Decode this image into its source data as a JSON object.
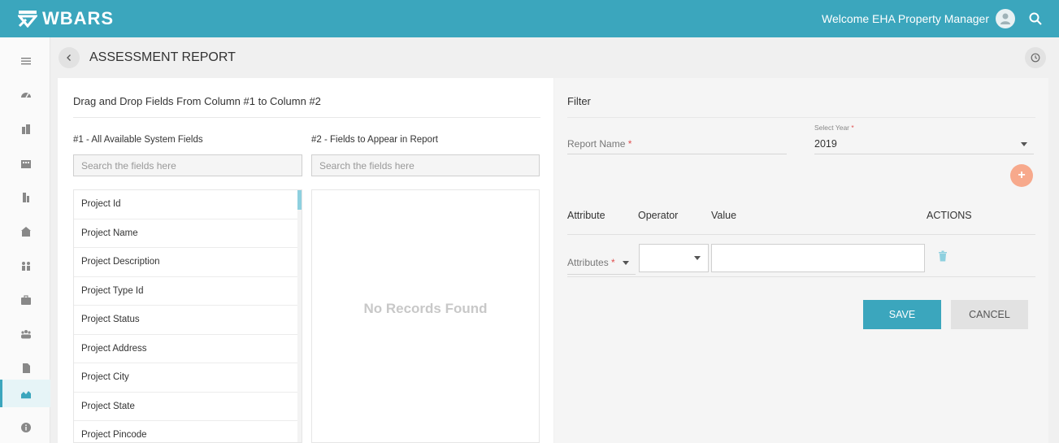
{
  "app": {
    "brand": "WBARS",
    "welcome": "Welcome EHA Property Manager",
    "accent_color": "#3ba6bd"
  },
  "header": {
    "title": "ASSESSMENT REPORT"
  },
  "sidebar": {
    "items": [
      {
        "icon": "hamburger-icon"
      },
      {
        "icon": "dashboard-icon"
      },
      {
        "icon": "building-icon"
      },
      {
        "icon": "apartment-icon"
      },
      {
        "icon": "tower-icon"
      },
      {
        "icon": "house-icon"
      },
      {
        "icon": "people-icon"
      },
      {
        "icon": "briefcase-icon"
      },
      {
        "icon": "group-icon"
      },
      {
        "icon": "document-icon"
      },
      {
        "icon": "report-chart-icon",
        "active": true
      },
      {
        "icon": "info-icon"
      }
    ]
  },
  "fields_panel": {
    "title": "Drag and Drop Fields From Column #1 to Column #2",
    "column1_label": "#1 - All Available System Fields",
    "column2_label": "#2 - Fields to Appear in Report",
    "search_placeholder": "Search the fields here",
    "available_fields": [
      "Project Id",
      "Project Name",
      "Project Description",
      "Project Type Id",
      "Project Status",
      "Project Address",
      "Project City",
      "Project State",
      "Project Pincode"
    ],
    "empty_text": "No Records Found"
  },
  "filter_panel": {
    "title": "Filter",
    "report_name_label": "Report Name",
    "required_mark": "*",
    "select_year_label": "Select Year",
    "select_year_value": "2019",
    "add_symbol": "+",
    "headers": {
      "attribute": "Attribute",
      "operator": "Operator",
      "value": "Value",
      "actions": "ACTIONS"
    },
    "attributes_label": "Attributes",
    "save_label": "SAVE",
    "cancel_label": "CANCEL"
  }
}
